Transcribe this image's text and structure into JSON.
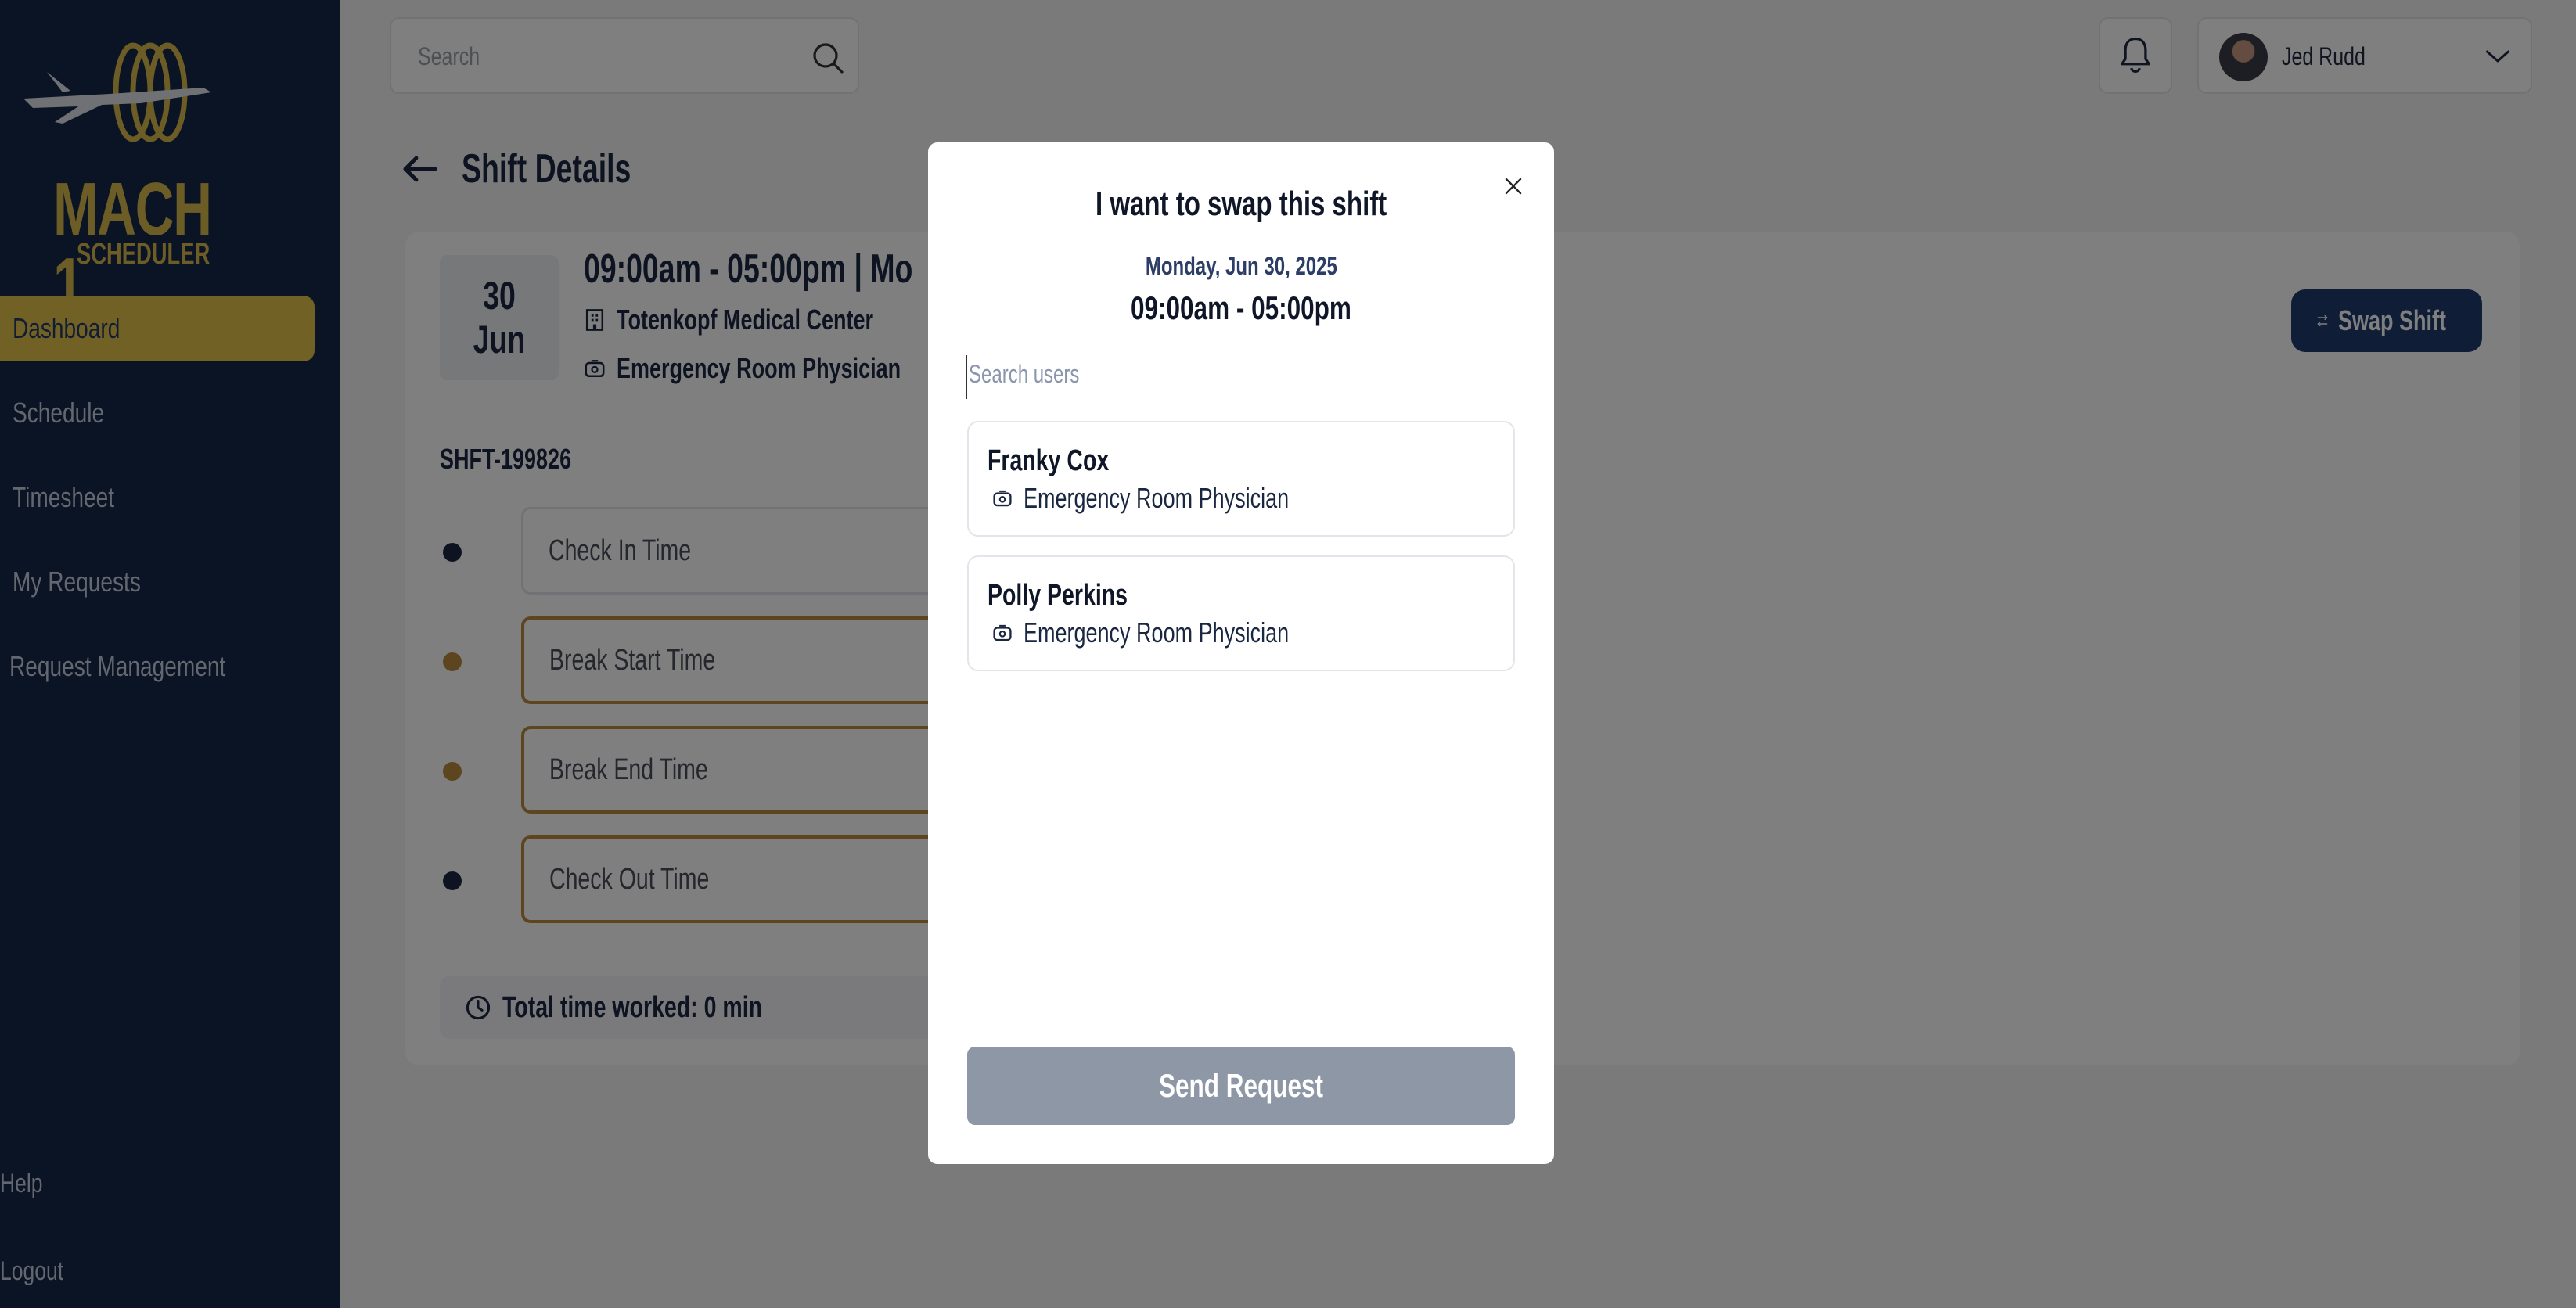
{
  "app": {
    "logo_main": "MACH 1",
    "logo_sub": "SCHEDULER"
  },
  "sidebar": {
    "items": [
      {
        "label": "Dashboard",
        "active": true
      },
      {
        "label": "Schedule"
      },
      {
        "label": "Timesheet"
      },
      {
        "label": "My Requests"
      },
      {
        "label": "Request Management"
      }
    ],
    "bottom": [
      {
        "label": "Help"
      },
      {
        "label": "Logout"
      }
    ]
  },
  "topbar": {
    "search_placeholder": "Search",
    "user_name": "Jed Rudd"
  },
  "page": {
    "title": "Shift Details"
  },
  "shift": {
    "day": "30",
    "month": "Jun",
    "time_title": "09:00am - 05:00pm | Mo",
    "location": "Totenkopf Medical Center",
    "role": "Emergency Room Physician",
    "id": "SHFT-199826",
    "swap_label": "Swap Shift",
    "timeline": [
      {
        "label": "Check In Time",
        "dot": "#1a2742"
      },
      {
        "label": "Break Start Time",
        "dot": "#b98a3e"
      },
      {
        "label": "Break End Time",
        "dot": "#b98a3e"
      },
      {
        "label": "Check Out Time",
        "dot": "#1a2742"
      }
    ],
    "total_label": "Total time worked: 0 min"
  },
  "modal": {
    "title": "I want to swap this shift",
    "date": "Monday, Jun 30, 2025",
    "time": "09:00am - 05:00pm",
    "search_placeholder": "Search users",
    "users": [
      {
        "name": "Franky Cox",
        "role": "Emergency Room Physician"
      },
      {
        "name": "Polly Perkins",
        "role": "Emergency Room Physician"
      }
    ],
    "send_label": "Send Request"
  },
  "colors": {
    "sidebar_bg": "#172849",
    "accent_gold": "#e5c24a",
    "primary_navy": "#1f3a6e",
    "disabled_btn": "#8e97a5"
  }
}
